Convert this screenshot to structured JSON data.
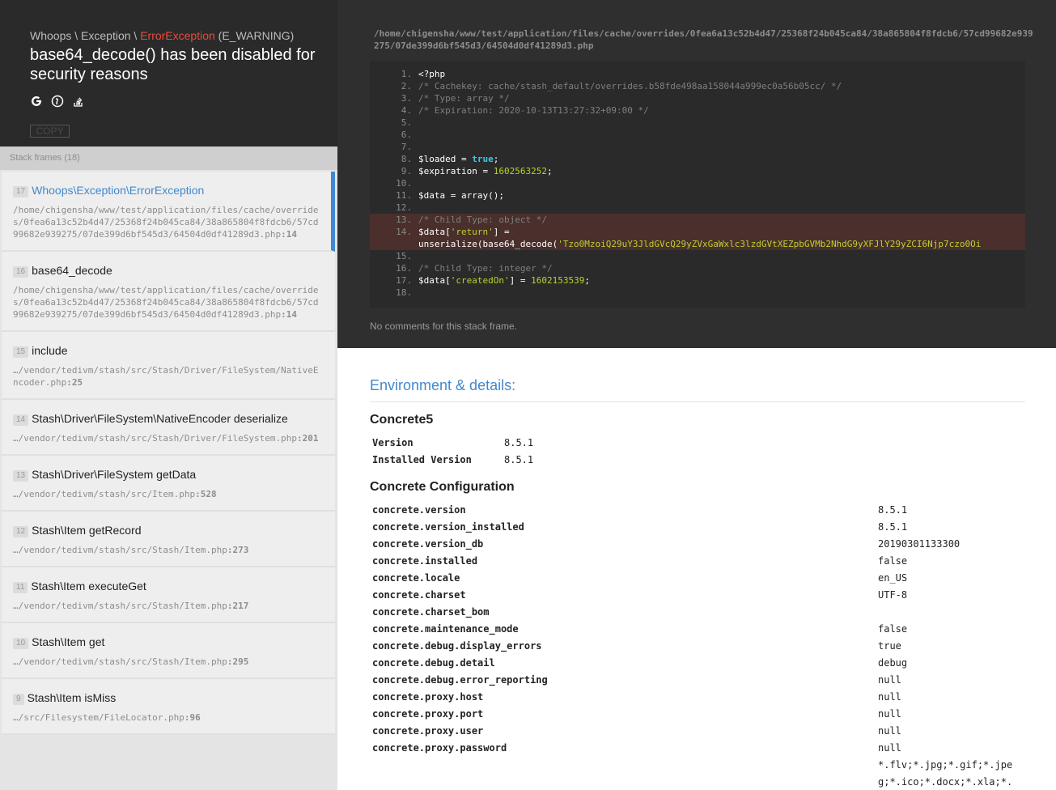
{
  "header": {
    "class_whoops": "Whoops",
    "sep1": " \\ ",
    "class_exception": "Exception",
    "sep2": " \\ ",
    "class_error": "ErrorException",
    "error_type": " (E_WARNING)",
    "message": "base64_decode() has been disabled for security reasons",
    "icons": [
      "google-search-icon",
      "duckduckgo-search-icon",
      "stackoverflow-search-icon"
    ],
    "copy_label": "COPY"
  },
  "stack": {
    "title": "Stack frames (18)",
    "frames": [
      {
        "index": "17",
        "name": "Whoops\\Exception\\ErrorException",
        "file": "/home/chigensha/www/test/application/files/cache/overrides/0fea6a13c52b4d47/25368f24b045ca84/38a865804f8fdcb6/57cd99682e939275/07de399d6bf545d3/64504d0df41289d3.php",
        "line": ":14"
      },
      {
        "index": "16",
        "name": "base64_decode",
        "file": "/home/chigensha/www/test/application/files/cache/overrides/0fea6a13c52b4d47/25368f24b045ca84/38a865804f8fdcb6/57cd99682e939275/07de399d6bf545d3/64504d0df41289d3.php",
        "line": ":14"
      },
      {
        "index": "15",
        "name": "include",
        "file": "…/vendor/tedivm/stash/src/Stash/Driver/FileSystem/NativeEncoder.php",
        "line": ":25"
      },
      {
        "index": "14",
        "name": "Stash\\Driver\\FileSystem\\NativeEncoder deserialize",
        "file": "…/vendor/tedivm/stash/src/Stash/Driver/FileSystem.php",
        "line": ":201"
      },
      {
        "index": "13",
        "name": "Stash\\Driver\\FileSystem getData",
        "file": "…/vendor/tedivm/stash/src/Item.php",
        "line": ":528"
      },
      {
        "index": "12",
        "name": "Stash\\Item getRecord",
        "file": "…/vendor/tedivm/stash/src/Stash/Item.php",
        "line": ":273"
      },
      {
        "index": "11",
        "name": "Stash\\Item executeGet",
        "file": "…/vendor/tedivm/stash/src/Stash/Item.php",
        "line": ":217"
      },
      {
        "index": "10",
        "name": "Stash\\Item get",
        "file": "…/vendor/tedivm/stash/src/Stash/Item.php",
        "line": ":295"
      },
      {
        "index": "9",
        "name": "Stash\\Item isMiss",
        "file": "…/src/Filesystem/FileLocator.php",
        "line": ":96"
      }
    ]
  },
  "code": {
    "file_path": "/home/chigensha/www/test/application/files/cache/overrides/0fea6a13c52b4d47/25368f24b045ca84/38a865804f8fdcb6/57cd99682e939275/07de399d6bf545d3/64504d0df41289d3.php",
    "comments": "No comments for this stack frame.",
    "lines": [
      {
        "no": "1.",
        "segs": [
          {
            "t": "<?php",
            "c": ""
          }
        ]
      },
      {
        "no": "2.",
        "segs": [
          {
            "t": "/* Cachekey: cache/stash_default/overrides.b58fde498aa158044a999ec0a56b05cc/ */",
            "c": "cm"
          }
        ]
      },
      {
        "no": "3.",
        "segs": [
          {
            "t": "/* Type: array */",
            "c": "cm"
          }
        ]
      },
      {
        "no": "4.",
        "segs": [
          {
            "t": "/* Expiration: 2020-10-13T13:27:32+09:00 */",
            "c": "cm"
          }
        ]
      },
      {
        "no": "5.",
        "segs": []
      },
      {
        "no": "6.",
        "segs": []
      },
      {
        "no": "7.",
        "segs": []
      },
      {
        "no": "8.",
        "segs": [
          {
            "t": "$loaded = ",
            "c": ""
          },
          {
            "t": "true",
            "c": "kw"
          },
          {
            "t": ";",
            "c": ""
          }
        ]
      },
      {
        "no": "9.",
        "segs": [
          {
            "t": "$expiration = ",
            "c": ""
          },
          {
            "t": "1602563252",
            "c": "num"
          },
          {
            "t": ";",
            "c": ""
          }
        ]
      },
      {
        "no": "10.",
        "segs": []
      },
      {
        "no": "11.",
        "segs": [
          {
            "t": "$data = array();",
            "c": ""
          }
        ]
      },
      {
        "no": "12.",
        "segs": []
      },
      {
        "no": "13.",
        "hl": true,
        "segs": [
          {
            "t": "/* Child Type: object */",
            "c": "cm"
          }
        ]
      },
      {
        "no": "14.",
        "hl": true,
        "segs": [
          {
            "t": "$data[",
            "c": ""
          },
          {
            "t": "'return'",
            "c": "str"
          },
          {
            "t": "] =",
            "c": ""
          }
        ]
      },
      {
        "no": "",
        "hl": true,
        "segs": [
          {
            "t": "unserialize(base64_decode(",
            "c": ""
          },
          {
            "t": "'Tzo0MzoiQ29uY3JldGVcQ29yZVxGaWxlc3lzdGVtXEZpbGVMb2NhdG9yXFJlY29yZCI6Njp7czo0Oi",
            "c": "str"
          }
        ]
      },
      {
        "no": "15.",
        "hl": false,
        "segs": []
      },
      {
        "no": "16.",
        "segs": [
          {
            "t": "/* Child Type: integer */",
            "c": "cm"
          }
        ]
      },
      {
        "no": "17.",
        "segs": [
          {
            "t": "$data[",
            "c": ""
          },
          {
            "t": "'createdOn'",
            "c": "str"
          },
          {
            "t": "] = ",
            "c": ""
          },
          {
            "t": "1602153539",
            "c": "num"
          },
          {
            "t": ";",
            "c": ""
          }
        ]
      },
      {
        "no": "18.",
        "segs": []
      }
    ]
  },
  "env": {
    "title": "Environment & details:",
    "sections": [
      {
        "title": "Concrete5",
        "rows": [
          {
            "key": "Version",
            "value": "8.5.1"
          },
          {
            "key": "Installed Version",
            "value": "8.5.1"
          }
        ]
      },
      {
        "title": "Concrete Configuration",
        "rows": [
          {
            "key": "concrete.version",
            "value": "8.5.1"
          },
          {
            "key": "concrete.version_installed",
            "value": "8.5.1"
          },
          {
            "key": "concrete.version_db",
            "value": "20190301133300"
          },
          {
            "key": "concrete.installed",
            "value": "false"
          },
          {
            "key": "concrete.locale",
            "value": "en_US"
          },
          {
            "key": "concrete.charset",
            "value": "UTF-8"
          },
          {
            "key": "concrete.charset_bom",
            "value": ""
          },
          {
            "key": "concrete.maintenance_mode",
            "value": "false"
          },
          {
            "key": "concrete.debug.display_errors",
            "value": "true"
          },
          {
            "key": "concrete.debug.detail",
            "value": "debug"
          },
          {
            "key": "concrete.debug.error_reporting",
            "value": "null"
          },
          {
            "key": "concrete.proxy.host",
            "value": "null"
          },
          {
            "key": "concrete.proxy.port",
            "value": "null"
          },
          {
            "key": "concrete.proxy.user",
            "value": "null"
          },
          {
            "key": "concrete.proxy.password",
            "value": "null"
          },
          {
            "key": "",
            "value": "*.flv;*.jpg;*.gif;*.jpe"
          },
          {
            "key": "",
            "value": "g;*.ico;*.docx;*.xla;*."
          }
        ]
      }
    ]
  }
}
